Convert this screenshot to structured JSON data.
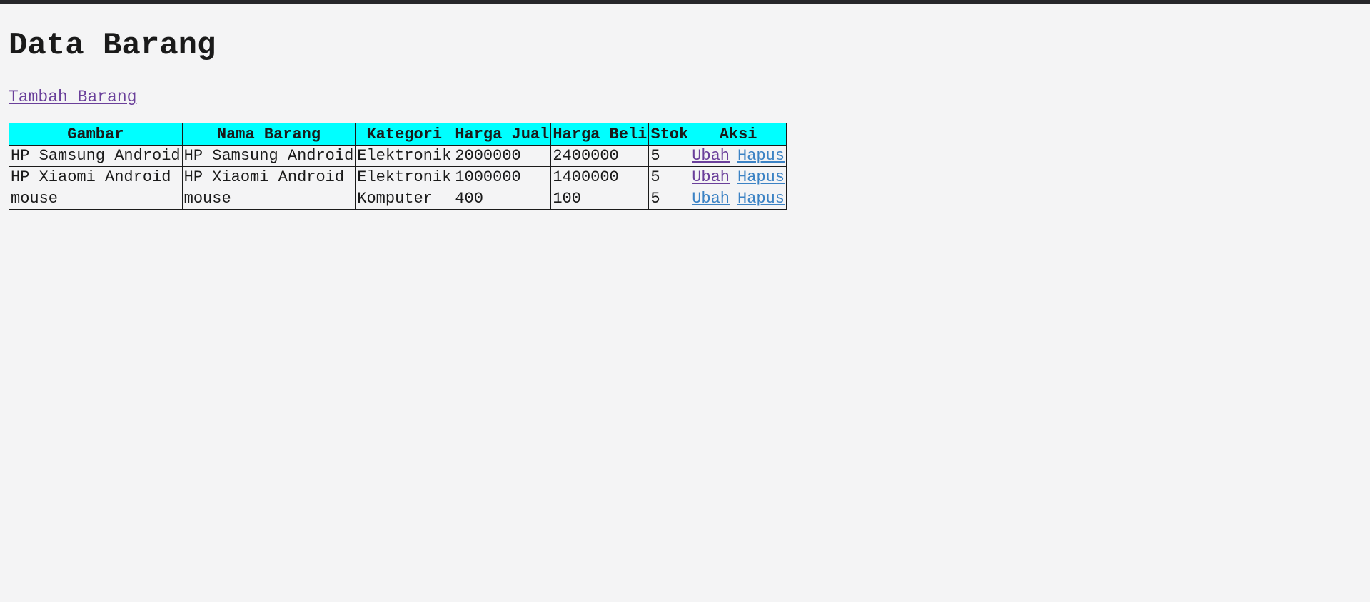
{
  "page": {
    "title": "Data Barang",
    "add_link": "Tambah Barang"
  },
  "table": {
    "headers": [
      "Gambar",
      "Nama Barang",
      "Kategori",
      "Harga Jual",
      "Harga Beli",
      "Stok",
      "Aksi"
    ],
    "rows": [
      {
        "gambar": "HP Samsung Android",
        "nama": "HP Samsung Android",
        "kategori": "Elektronik",
        "harga_jual": "2000000",
        "harga_beli": "2400000",
        "stok": "5",
        "ubah": "Ubah",
        "hapus": "Hapus"
      },
      {
        "gambar": "HP Xiaomi Android",
        "nama": "HP Xiaomi Android",
        "kategori": "Elektronik",
        "harga_jual": "1000000",
        "harga_beli": "1400000",
        "stok": "5",
        "ubah": "Ubah",
        "hapus": "Hapus"
      },
      {
        "gambar": "mouse",
        "nama": "mouse",
        "kategori": "Komputer",
        "harga_jual": "400",
        "harga_beli": "100",
        "stok": "5",
        "ubah": "Ubah",
        "hapus": "Hapus"
      }
    ]
  },
  "colors": {
    "header_bg": "#00ffff",
    "visited_link": "#6a3f9a",
    "link": "#3b82c4",
    "page_bg": "#f4f4f5"
  }
}
